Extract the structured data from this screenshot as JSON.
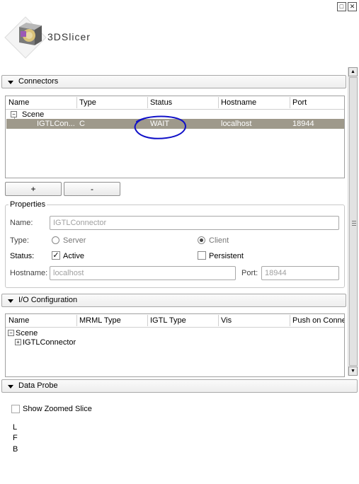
{
  "window": {
    "float_icon": "float-window-icon",
    "close_icon": "close-window-icon"
  },
  "logo": {
    "text": "3DSlicer"
  },
  "connectors_section": {
    "title": "Connectors",
    "columns": [
      "Name",
      "Type",
      "Status",
      "Hostname",
      "Port"
    ],
    "tree_root": "Scene",
    "rows": [
      {
        "name": "IGTLCon...",
        "type": "C",
        "status": "WAIT",
        "hostname": "localhost",
        "port": "18944"
      }
    ],
    "annotation_color": "#1010c8",
    "add_button": "+",
    "remove_button": "-"
  },
  "properties": {
    "title": "Properties",
    "name_label": "Name:",
    "name_value": "IGTLConnector",
    "type_label": "Type:",
    "type_server": "Server",
    "type_client": "Client",
    "type_selected": "Client",
    "status_label": "Status:",
    "active_label": "Active",
    "active_checked": true,
    "persistent_label": "Persistent",
    "persistent_checked": false,
    "hostname_label": "Hostname:",
    "hostname_value": "localhost",
    "port_label": "Port:",
    "port_value": "18944"
  },
  "io_section": {
    "title": "I/O Configuration",
    "columns": [
      "Name",
      "MRML Type",
      "IGTL Type",
      "Vis",
      "Push on Conne"
    ],
    "tree_root": "Scene",
    "tree_child": "IGTLConnector"
  },
  "data_probe": {
    "title": "Data Probe",
    "show_zoomed_label": "Show Zoomed Slice",
    "show_zoomed_checked": false,
    "coords": [
      "L",
      "F",
      "B"
    ]
  },
  "colors": {
    "selected_row": "#9e998b",
    "annotation": "#1010c8"
  }
}
